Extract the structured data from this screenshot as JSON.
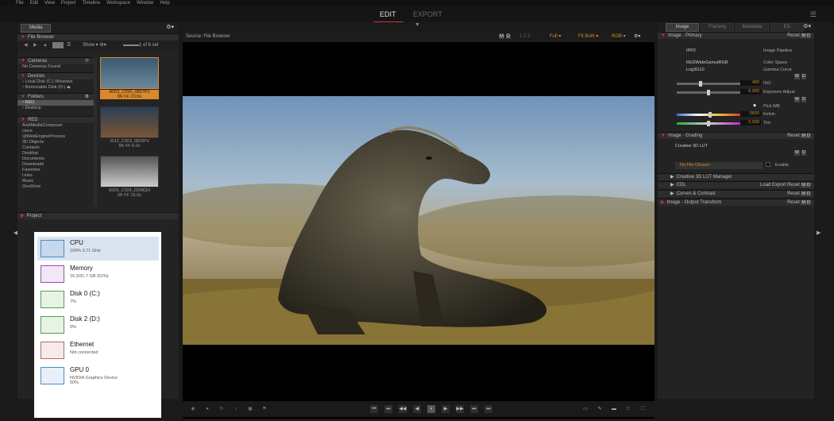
{
  "menu": [
    "File",
    "Edit",
    "View",
    "Project",
    "Timeline",
    "Workspace",
    "Window",
    "Help"
  ],
  "modes": {
    "edit": "EDIT",
    "export": "EXPORT"
  },
  "left": {
    "tab": "Media",
    "file_browser": "File Browser",
    "show_label": "Show",
    "count": "1 of 6 sel",
    "cameras": {
      "title": "Cameras",
      "empty": "No Cameras Found"
    },
    "devices": {
      "title": "Devices",
      "items": [
        "Local Disk (C:) Windows",
        "Removable Disk (D:)"
      ]
    },
    "folders": {
      "title": "Folders",
      "items": [
        "RED",
        "Desktop"
      ]
    },
    "red": {
      "title": "RED",
      "items": [
        "AvidMediaComposer",
        "cisco",
        "QtWebEngineProcess",
        "3D Objects",
        "Contacts",
        "Desktop",
        "Documents",
        "Downloads",
        "Favorites",
        "Links",
        "Music",
        "OneDrive"
      ]
    },
    "thumbs": [
      {
        "name": "A003_C050_0807P0",
        "info": "8K FF  23.9s",
        "colors": [
          "#3a5a70",
          "#6c8799"
        ],
        "selected": true
      },
      {
        "name": "J012_C003_0823FV",
        "info": "8K FF  6.0s",
        "colors": [
          "#2b3f55",
          "#7a5535"
        ],
        "selected": false
      },
      {
        "name": "S005_C024_0208QH",
        "info": "5K FF  16.0s",
        "colors": [
          "#555",
          "#ccc"
        ],
        "selected": false
      }
    ],
    "project": "Project"
  },
  "taskmgr": [
    {
      "name": "CPU",
      "sub": "100%  3.71 GHz",
      "color": "#4a8cc7",
      "selected": true
    },
    {
      "name": "Memory",
      "sub": "16.3/31.7 GB (51%)",
      "color": "#9b4ab5",
      "selected": false
    },
    {
      "name": "Disk 0 (C:)",
      "sub": "7%",
      "color": "#4aa54a",
      "selected": false
    },
    {
      "name": "Disk 2 (D:)",
      "sub": "0%",
      "color": "#4aa54a",
      "selected": false
    },
    {
      "name": "Ethernet",
      "sub": "Not connected",
      "color": "#b56a6a",
      "selected": false
    },
    {
      "name": "GPU 0",
      "sub": "NVIDIA Graphics Device\n50%",
      "color": "#4a8cc7",
      "selected": false
    }
  ],
  "viewer": {
    "source": "Source: File Browser",
    "full": "Full",
    "fit": "Fit Both",
    "rgb": "RGB"
  },
  "right": {
    "tabs": [
      "Image",
      "Framing",
      "Metadata",
      "Etc"
    ],
    "primary": "Image · Primary",
    "reset": "Reset",
    "ipp2": "IPP2",
    "pipeline": "Image Pipeline",
    "colorspace_val": "REDWideGamutRGB",
    "colorspace": "Color Space",
    "gamma_val": "Log3G10",
    "gamma": "Gamma Curve",
    "iso_val": "400",
    "iso": "ISO",
    "exposure_val": "0.000",
    "exposure": "Exposure Adjust",
    "pickwb": "Pick WB",
    "kelvin_val": "5600",
    "kelvin": "Kelvin",
    "tint_val": "0.000",
    "tint": "Tint",
    "grading": "Image · Grading",
    "lut": "Creative 3D LUT",
    "nofile": "No File Chosen",
    "enable": "Enable",
    "lutmgr": "Creative 3D LUT Manager",
    "cdl": "CDL",
    "load": "Load",
    "export": "Export",
    "curves": "Curves & Contrast",
    "output": "Image · Output Transform"
  }
}
